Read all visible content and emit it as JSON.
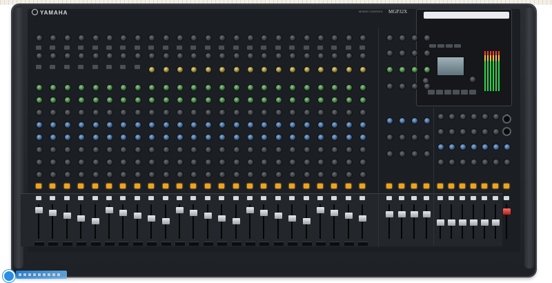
{
  "image": {
    "subject": "mixing-console",
    "colors": {
      "body": "#1e2125",
      "panel": "#1b1e22",
      "accent_orange": "#f0a21a",
      "fader_red": "#e0342a"
    }
  },
  "console": {
    "brand": "YAMAHA",
    "model": "MGP32X",
    "model_sub": "MIXING CONSOLE",
    "input_channels": 24,
    "stereo_channels": 4,
    "fader_count": 34
  }
}
